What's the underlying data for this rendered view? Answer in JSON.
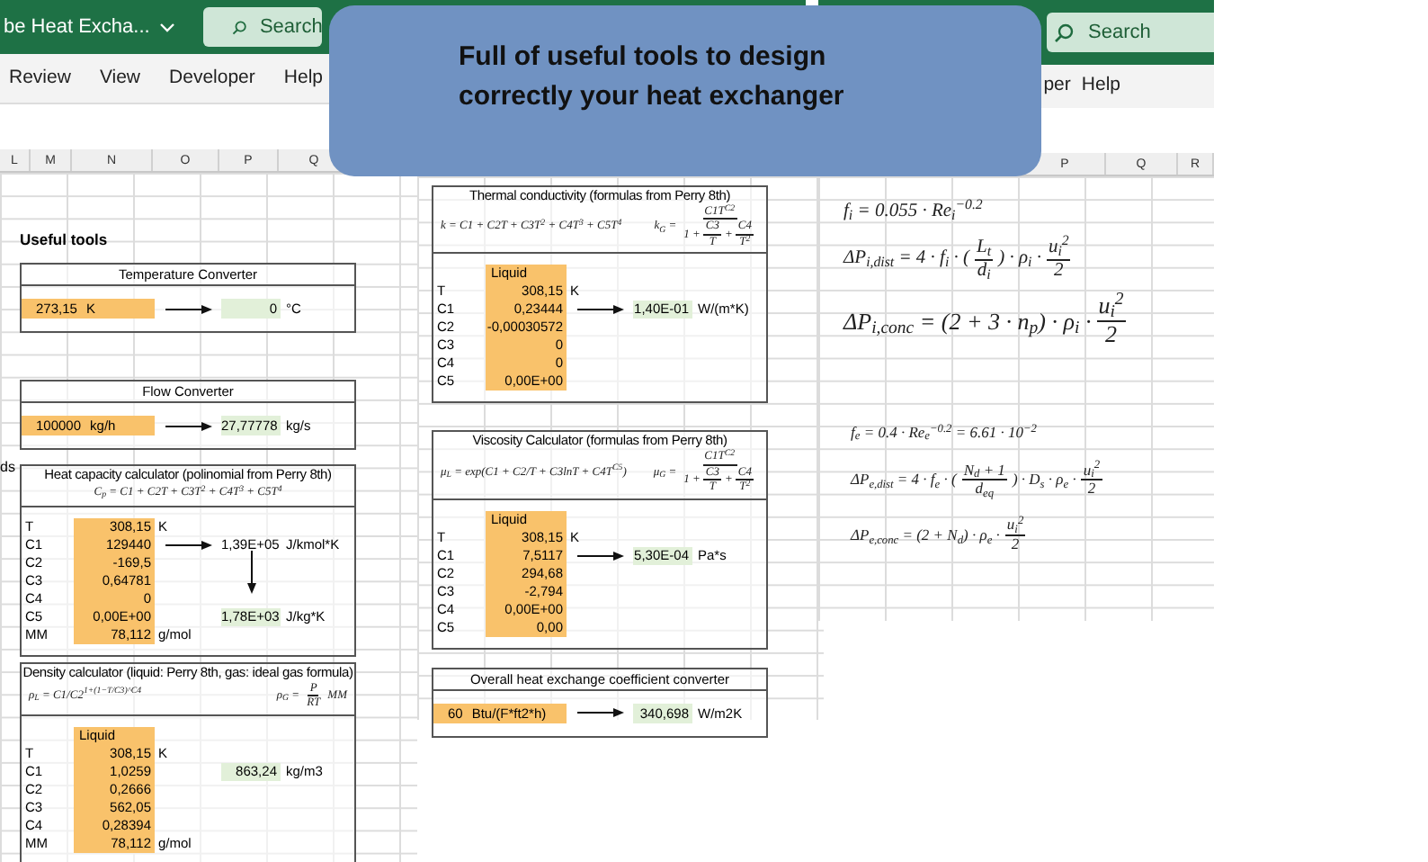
{
  "callout": {
    "lines": [
      "Full of useful tools to design",
      "correctly your heat exchanger"
    ]
  },
  "left_window": {
    "title": "be Heat Excha...",
    "search": {
      "placeholder": "Search"
    },
    "ribbon_tabs": [
      "Review",
      "View",
      "Developer",
      "Help"
    ],
    "column_headers": [
      "L",
      "M",
      "N",
      "O",
      "P",
      "Q"
    ],
    "side_text": "ds",
    "heading": "Useful tools",
    "panels": [
      {
        "kind": "converter",
        "title": "Temperature Converter",
        "input": {
          "value": "273,15",
          "unit": "K"
        },
        "output": {
          "value": "0",
          "unit": "°C"
        }
      },
      {
        "kind": "converter",
        "title": "Flow Converter",
        "input": {
          "value": "100000",
          "unit": "kg/h"
        },
        "output": {
          "value": "27,77778",
          "unit": "kg/s"
        }
      },
      {
        "kind": "calculator",
        "title": "Heat capacity calculator  (polinomial from Perry 8th)",
        "formulas": [
          [
            {
              "kind": "text",
              "text": "C$_{p}$ = C1 + C2T + C3T$^{2}$ + C4T$^{3}$ + C5T$^{4}$"
            }
          ]
        ],
        "rows": [
          {
            "label": "T",
            "value": "308,15",
            "unit": "K"
          },
          {
            "label": "C1",
            "value": "129440",
            "right_arrow": true,
            "result": {
              "value": "1,39E+05",
              "unit": "J/kmol*K",
              "highlighted": false
            }
          },
          {
            "label": "C2",
            "value": "-169,5"
          },
          {
            "label": "C3",
            "value": "0,64781",
            "down_arrow": true
          },
          {
            "label": "C4",
            "value": "0"
          },
          {
            "label": "C5",
            "value": "0,00E+00",
            "result": {
              "value": "1,78E+03",
              "unit": "J/kg*K",
              "highlighted": true
            }
          },
          {
            "label": "MM",
            "value": "78,112",
            "unit": "g/mol"
          }
        ]
      },
      {
        "kind": "calculator",
        "title": "Density calculator  (liquid: Perry 8th, gas: ideal gas formula)",
        "formulas": [
          [
            {
              "kind": "text",
              "text": "ρ$_{L}$ = C1/C2$^{1+(1−T/C3)^C4}$"
            }
          ],
          [
            {
              "kind": "text",
              "text": "ρ$_{G}$ ="
            },
            {
              "kind": "frac",
              "num": [
                {
                  "kind": "text",
                  "text": "P"
                }
              ],
              "den": [
                {
                  "kind": "text",
                  "text": "RT"
                }
              ]
            },
            {
              "kind": "text",
              "text": "MM"
            }
          ]
        ],
        "column_label": "Liquid",
        "rows": [
          {
            "label": "T",
            "value": "308,15",
            "unit": "K"
          },
          {
            "label": "C1",
            "value": "1,0259",
            "result": {
              "value": "863,24",
              "unit": "kg/m3",
              "highlighted": true
            }
          },
          {
            "label": "C2",
            "value": "0,2666"
          },
          {
            "label": "C3",
            "value": "562,05"
          },
          {
            "label": "C4",
            "value": "0,28394"
          },
          {
            "label": "MM",
            "value": "78,112",
            "unit": "g/mol"
          }
        ]
      }
    ]
  },
  "middle_window": {
    "panels": [
      {
        "kind": "calculator",
        "title": "Thermal conductivity (formulas from Perry 8th)",
        "formulas": [
          [
            {
              "kind": "text",
              "text": "k = C1 + C2T + C3T$^{2}$ + C4T$^{3}$ + C5T$^{4}$"
            }
          ],
          [
            {
              "kind": "text",
              "text": "k$_{G}$ ="
            },
            {
              "kind": "frac",
              "num": [
                {
                  "kind": "text",
                  "text": "C1T$^{C2}$"
                }
              ],
              "den": [
                {
                  "kind": "text",
                  "text": "1 +"
                },
                {
                  "kind": "frac",
                  "num": [
                    {
                      "kind": "text",
                      "text": "C3"
                    }
                  ],
                  "den": [
                    {
                      "kind": "text",
                      "text": "T"
                    }
                  ]
                },
                {
                  "kind": "text",
                  "text": "+"
                },
                {
                  "kind": "frac",
                  "num": [
                    {
                      "kind": "text",
                      "text": "C4"
                    }
                  ],
                  "den": [
                    {
                      "kind": "text",
                      "text": "T$^{2}$"
                    }
                  ]
                }
              ]
            }
          ]
        ],
        "column_label": "Liquid",
        "rows": [
          {
            "label": "T",
            "value": "308,15",
            "unit": "K"
          },
          {
            "label": "C1",
            "value": "0,23444",
            "right_arrow": true,
            "result": {
              "value": "1,40E-01",
              "unit": "W/(m*K)",
              "highlighted": true
            }
          },
          {
            "label": "C2",
            "value": "-0,00030572"
          },
          {
            "label": "C3",
            "value": "0"
          },
          {
            "label": "C4",
            "value": "0"
          },
          {
            "label": "C5",
            "value": "0,00E+00"
          }
        ]
      },
      {
        "kind": "calculator",
        "title": "Viscosity Calculator (formulas from  Perry 8th)",
        "formulas": [
          [
            {
              "kind": "text",
              "text": "μ$_{L}$ = exp(C1 + C2/T + C3lnT + C4T$^{C5}$)"
            }
          ],
          [
            {
              "kind": "text",
              "text": "μ$_{G}$ ="
            },
            {
              "kind": "frac",
              "num": [
                {
                  "kind": "text",
                  "text": "C1T$^{C2}$"
                }
              ],
              "den": [
                {
                  "kind": "text",
                  "text": "1 +"
                },
                {
                  "kind": "frac",
                  "num": [
                    {
                      "kind": "text",
                      "text": "C3"
                    }
                  ],
                  "den": [
                    {
                      "kind": "text",
                      "text": "T"
                    }
                  ]
                },
                {
                  "kind": "text",
                  "text": "+"
                },
                {
                  "kind": "frac",
                  "num": [
                    {
                      "kind": "text",
                      "text": "C4"
                    }
                  ],
                  "den": [
                    {
                      "kind": "text",
                      "text": "T$^{2}$"
                    }
                  ]
                }
              ]
            }
          ]
        ],
        "column_label": "Liquid",
        "rows": [
          {
            "label": "T",
            "value": "308,15",
            "unit": "K"
          },
          {
            "label": "C1",
            "value": "7,5117",
            "right_arrow": true,
            "result": {
              "value": "5,30E-04",
              "unit": "Pa*s",
              "highlighted": true
            }
          },
          {
            "label": "C2",
            "value": "294,68"
          },
          {
            "label": "C3",
            "value": "-2,794"
          },
          {
            "label": "C4",
            "value": "0,00E+00"
          },
          {
            "label": "C5",
            "value": "0,00"
          }
        ]
      },
      {
        "kind": "converter",
        "title": "Overall heat exchange coefficient converter",
        "input": {
          "value": "60",
          "unit": "Btu/(F*ft2*h)"
        },
        "output": {
          "value": "340,698",
          "unit": "W/m2K"
        }
      }
    ]
  },
  "right_window": {
    "search": {
      "placeholder": "Search"
    },
    "ribbon_tabs": [
      "per",
      "Help"
    ],
    "column_headers": [
      "P",
      "Q",
      "R"
    ],
    "tube_side_formulas": [
      [
        {
          "kind": "text",
          "text": "f$_{i}$ = 0.055 · Re$_{i}$$^{−0.2}$"
        }
      ],
      [
        {
          "kind": "text",
          "text": "ΔP$_{i,dist}$ = 4 · f$_{i}$ · ("
        },
        {
          "kind": "frac",
          "num": [
            {
              "kind": "text",
              "text": "L$_{t}$"
            }
          ],
          "den": [
            {
              "kind": "text",
              "text": "d$_{i}$"
            }
          ]
        },
        {
          "kind": "text",
          "text": ") · ρ$_{i}$ ·"
        },
        {
          "kind": "frac",
          "num": [
            {
              "kind": "text",
              "text": "u$_{i}$$^{2}$"
            }
          ],
          "den": [
            {
              "kind": "text",
              "text": "2"
            }
          ]
        }
      ],
      [
        {
          "kind": "text",
          "text": "ΔP$_{i,conc}$ = (2 + 3 · n$_{p}$) · ρ$_{i}$ ·"
        },
        {
          "kind": "frac",
          "num": [
            {
              "kind": "text",
              "text": "u$_{i}$$^{2}$"
            }
          ],
          "den": [
            {
              "kind": "text",
              "text": "2"
            }
          ]
        }
      ]
    ],
    "shell_side_formulas": [
      [
        {
          "kind": "text",
          "text": "f$_{e}$ = 0.4 · Re$_{e}$$^{−0.2}$ = 6.61 · 10$^{−2}$"
        }
      ],
      [
        {
          "kind": "text",
          "text": "ΔP$_{e,dist}$ = 4 · f$_{e}$ · ("
        },
        {
          "kind": "frac",
          "num": [
            {
              "kind": "text",
              "text": "N$_{d}$ + 1"
            }
          ],
          "den": [
            {
              "kind": "text",
              "text": "d$_{eq}$"
            }
          ]
        },
        {
          "kind": "text",
          "text": ") · D$_{s}$ · ρ$_{e}$ ·"
        },
        {
          "kind": "frac",
          "num": [
            {
              "kind": "text",
              "text": "u$_{i}$$^{2}$"
            }
          ],
          "den": [
            {
              "kind": "text",
              "text": "2"
            }
          ]
        }
      ],
      [
        {
          "kind": "text",
          "text": "ΔP$_{e,conc}$ = (2 + N$_{d}$) · ρ$_{e}$ ·"
        },
        {
          "kind": "frac",
          "num": [
            {
              "kind": "text",
              "text": "u$_{i}$$^{2}$"
            }
          ],
          "den": [
            {
              "kind": "text",
              "text": "2"
            }
          ]
        }
      ]
    ]
  }
}
